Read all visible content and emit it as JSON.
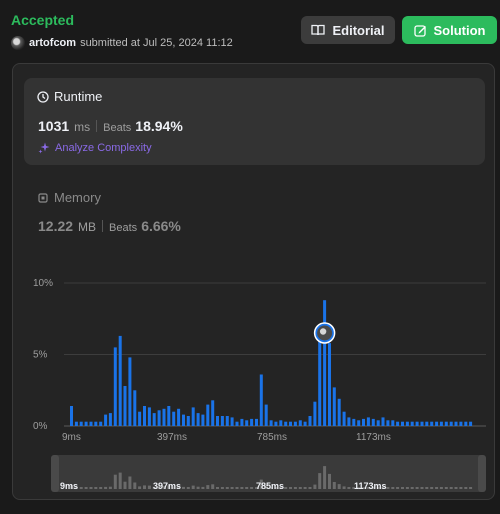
{
  "header": {
    "status": "Accepted",
    "username": "artofcom",
    "submitted_text": "submitted at Jul 25, 2024 11:12"
  },
  "buttons": {
    "editorial": "Editorial",
    "solution": "Solution"
  },
  "runtime": {
    "title": "Runtime",
    "value": "1031",
    "unit": "ms",
    "beats_label": "Beats",
    "beats": "18.94%",
    "analyze": "Analyze Complexity"
  },
  "memory": {
    "title": "Memory",
    "value": "12.22",
    "unit": "MB",
    "beats_label": "Beats",
    "beats": "6.66%"
  },
  "colors": {
    "accent_green": "#2cbb5d",
    "bar_blue": "#1a73e8",
    "purple": "#8a6ae6"
  },
  "chart_data": {
    "type": "bar",
    "ylabel_ticks": [
      "10%",
      "5%",
      "0%"
    ],
    "yticks": [
      10,
      5,
      0
    ],
    "ylim": [
      0,
      10
    ],
    "xtick_labels": [
      "9ms",
      "397ms",
      "785ms",
      "1173ms"
    ],
    "grid": true,
    "selected_value": 1031,
    "values": [
      1.4,
      0.3,
      0.3,
      0.3,
      0.3,
      0.3,
      0.3,
      0.8,
      0.9,
      5.5,
      6.3,
      2.8,
      4.8,
      2.5,
      1.0,
      1.4,
      1.3,
      0.9,
      1.1,
      1.2,
      1.4,
      1.0,
      1.2,
      0.8,
      0.7,
      1.3,
      0.9,
      0.8,
      1.5,
      1.8,
      0.7,
      0.7,
      0.7,
      0.6,
      0.3,
      0.5,
      0.4,
      0.5,
      0.5,
      3.6,
      1.5,
      0.4,
      0.3,
      0.4,
      0.3,
      0.3,
      0.3,
      0.4,
      0.3,
      0.7,
      1.7,
      6.1,
      8.8,
      5.8,
      2.7,
      1.9,
      1.0,
      0.6,
      0.5,
      0.4,
      0.5,
      0.6,
      0.5,
      0.4,
      0.6,
      0.4,
      0.4,
      0.3,
      0.3,
      0.3,
      0.3,
      0.3,
      0.3,
      0.3,
      0.3,
      0.3,
      0.3,
      0.3,
      0.3,
      0.3,
      0.3,
      0.3,
      0.3
    ]
  },
  "minimap": {
    "xtick_labels": [
      "9ms",
      "397ms",
      "785ms",
      "1173ms"
    ]
  }
}
